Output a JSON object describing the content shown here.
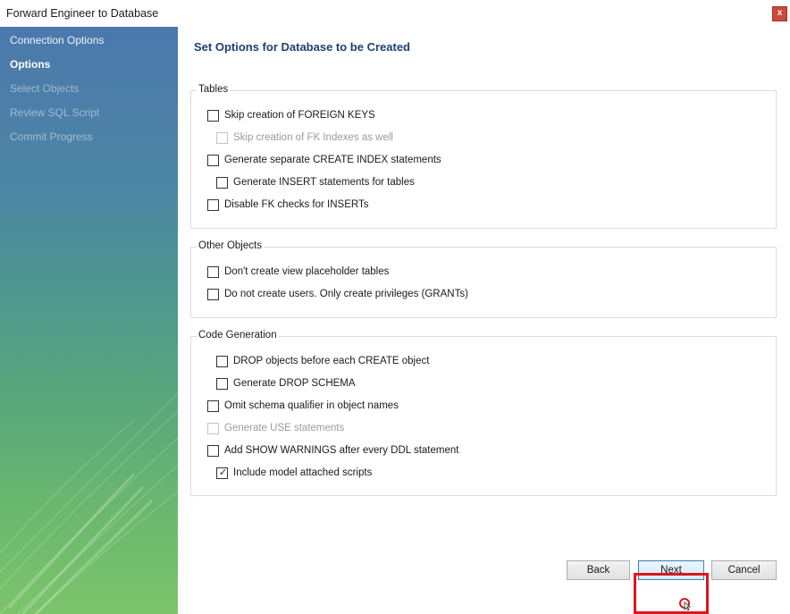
{
  "window": {
    "title": "Forward Engineer to Database",
    "close_label": "x"
  },
  "sidebar": {
    "steps": [
      {
        "label": "Connection Options",
        "state": "done"
      },
      {
        "label": "Options",
        "state": "active"
      },
      {
        "label": "Select Objects",
        "state": "pending"
      },
      {
        "label": "Review SQL Script",
        "state": "pending"
      },
      {
        "label": "Commit Progress",
        "state": "pending"
      }
    ]
  },
  "main": {
    "heading": "Set Options for Database to be Created",
    "tables": {
      "legend": "Tables",
      "options": [
        {
          "label": "Skip creation of FOREIGN KEYS",
          "checked": false,
          "enabled": true
        },
        {
          "label": "Skip creation of FK Indexes as well",
          "checked": false,
          "enabled": false
        },
        {
          "label": "Generate separate CREATE INDEX statements",
          "checked": false,
          "enabled": true
        },
        {
          "label": "Generate INSERT statements for tables",
          "checked": false,
          "enabled": true
        },
        {
          "label": "Disable FK checks for INSERTs",
          "checked": false,
          "enabled": true
        }
      ]
    },
    "other_objects": {
      "legend": "Other Objects",
      "options": [
        {
          "label": "Don't create view placeholder tables",
          "checked": false,
          "enabled": true
        },
        {
          "label": "Do not create users. Only create privileges (GRANTs)",
          "checked": false,
          "enabled": true
        }
      ]
    },
    "code_generation": {
      "legend": "Code Generation",
      "options": [
        {
          "label": "DROP objects before each CREATE object",
          "checked": false,
          "enabled": true
        },
        {
          "label": "Generate DROP SCHEMA",
          "checked": false,
          "enabled": true
        },
        {
          "label": "Omit schema qualifier in object names",
          "checked": false,
          "enabled": true
        },
        {
          "label": "Generate USE statements",
          "checked": false,
          "enabled": false
        },
        {
          "label": "Add SHOW WARNINGS after every DDL statement",
          "checked": false,
          "enabled": true
        },
        {
          "label": "Include model attached scripts",
          "checked": true,
          "enabled": true
        }
      ]
    }
  },
  "buttons": {
    "back": "Back",
    "next": "Next",
    "cancel": "Cancel"
  },
  "colors": {
    "heading": "#1f3f72",
    "highlight": "#e0151e",
    "close_button": "#c94a3b"
  }
}
